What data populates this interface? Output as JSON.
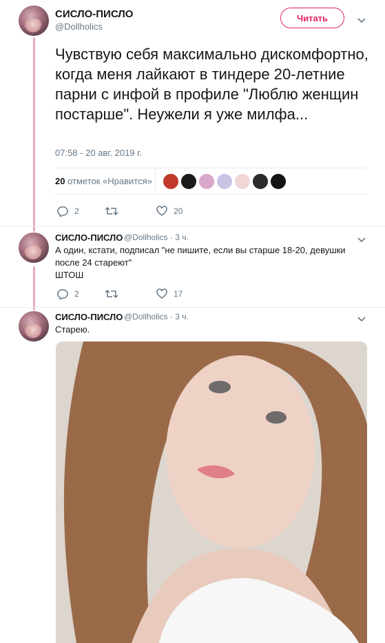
{
  "tweet": {
    "author_name": "СИСЛО-ПИСЛО",
    "author_handle": "@Dollholics",
    "follow_label": "Читать",
    "text": "Чувствую себя максимально дискомфортно, когда меня лайкают в тиндере 20-летние парни с инфой в профиле \"Люблю женщин постарше\". Неужели я уже милфа...",
    "timestamp": "07:58 - 20 авг. 2019 г.",
    "likes_count": "20",
    "likes_label": "отметок «Нравится»",
    "replies": "2",
    "likes": "20"
  },
  "reply1": {
    "author_name": "СИСЛО-ПИСЛО",
    "handle_time": "@Dollholics · 3 ч.",
    "text_line1": "А один, кстати, подписал \"не пишите, если вы старше 18-20, девушки после 24 стареют\"",
    "text_line2": "ШТОШ",
    "replies": "2",
    "likes": "17"
  },
  "reply2": {
    "author_name": "СИСЛО-ПИСЛО",
    "handle_time": "@Dollholics · 3 ч.",
    "text": "Старею."
  },
  "liker_colors": [
    "#c0392b",
    "#1c1c1c",
    "#d8a7c9",
    "#c9c3e6",
    "#f2d6d6",
    "#2a2a2a",
    "#141414"
  ],
  "colors": {
    "accent": "#e0245e",
    "thread_line": "#e6a9c2",
    "meta": "#657786"
  }
}
